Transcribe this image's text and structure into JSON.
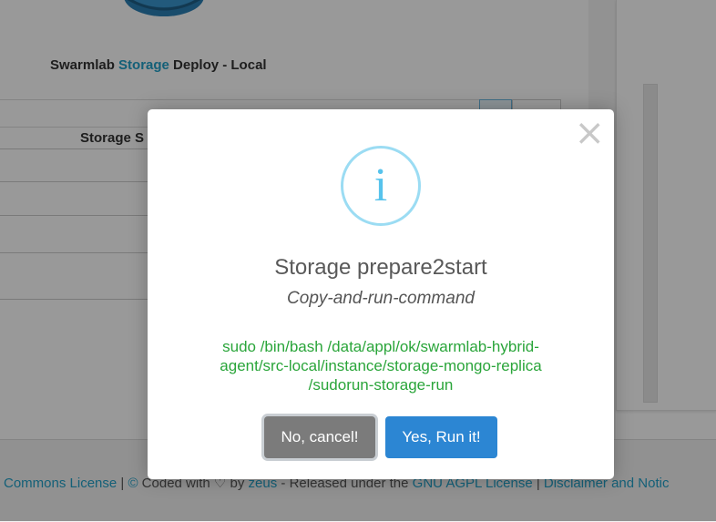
{
  "page": {
    "title_prefix": "Swarmlab ",
    "title_accent": "Storage",
    "title_suffix": " Deploy - Local",
    "table_header": "Storage S"
  },
  "footer": {
    "license": "Commons License",
    "sep1": " | ",
    "copyright": "©",
    "coded_with": " Coded with ",
    "heart": "♡",
    "by": " by ",
    "author": "zeus",
    "released": " - Released under the ",
    "agpl": "GNU AGPL License",
    "sep2": " | ",
    "disclaimer": "Disclaimer and Notic"
  },
  "modal": {
    "icon": "i",
    "title": "Storage prepare2start",
    "subtitle": "Copy-and-run-command",
    "command_line1": "sudo /bin/bash /data/appl/ok/swarmlab-hybrid-",
    "command_line2": "agent/src-local/instance/storage-mongo-replica",
    "command_line3": "/sudorun-storage-run",
    "close_glyph": "×",
    "cancel_label": "No, cancel!",
    "confirm_label": "Yes, Run it!"
  },
  "colors": {
    "accent": "#22a0c8",
    "command_text": "#2aa53a",
    "confirm_button": "#2c86d3",
    "cancel_button": "#7b7b7b",
    "info_icon": "#57c3ec"
  }
}
